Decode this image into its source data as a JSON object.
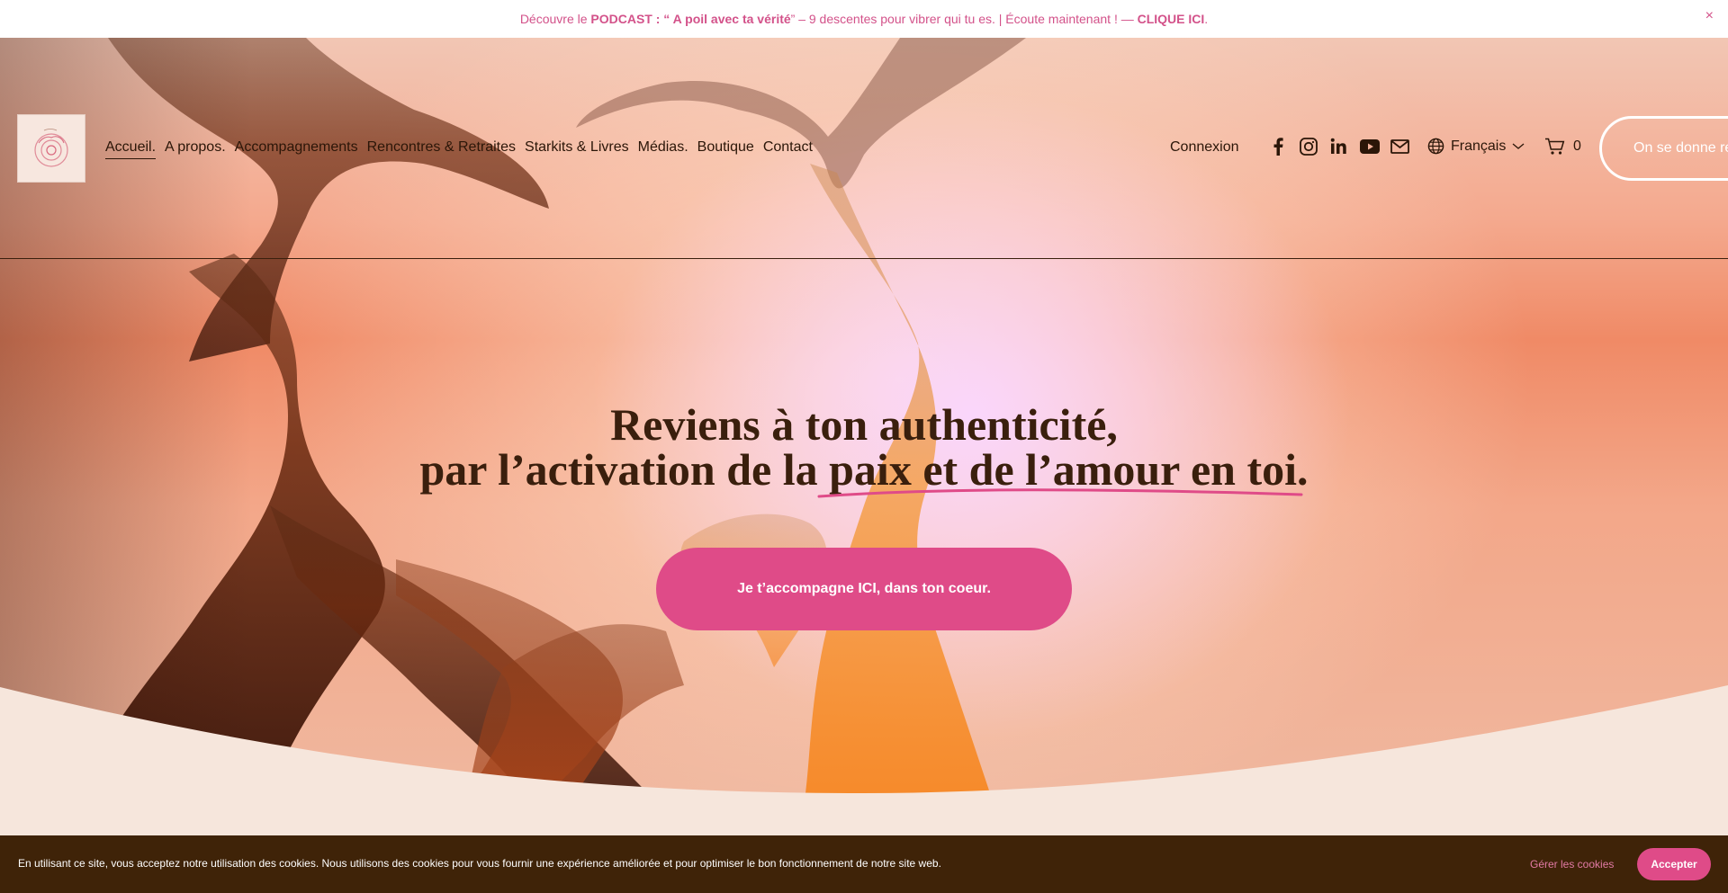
{
  "announcement": {
    "prefix": "Découvre le ",
    "podcast_label": "PODCAST",
    "sep": " : “ ",
    "podcast_title": "A poil avec ta vérité",
    "middle": "” – 9 descentes pour vibrer qui tu es. | Écoute maintenant ! — ",
    "cta": "CLIQUE ICI",
    "suffix": ".",
    "close": "×"
  },
  "nav": {
    "items": [
      {
        "label": "Accueil."
      },
      {
        "label": "A propos."
      },
      {
        "label": "Accompagnements"
      },
      {
        "label": "Rencontres & Retraites"
      },
      {
        "label": "Starkits & Livres"
      },
      {
        "label": "Médias."
      },
      {
        "label": "Boutique"
      },
      {
        "label": "Contact"
      }
    ],
    "login": "Connexion",
    "language": "Français",
    "cart_count": "0",
    "cta": "On se donne rendez-vous"
  },
  "hero": {
    "line1": "Reviens à ton authenticité,",
    "line2_pre": "par l’activation de la ",
    "line2_hl": "paix et de l’amour en toi",
    "line2_post": ".",
    "button": "Je t’accompagne ICI, dans ton coeur."
  },
  "cookie": {
    "message": "En utilisant ce site, vous acceptez notre utilisation des cookies. Nous utilisons des cookies pour vous fournir une expérience améliorée et pour optimiser le bon fonctionnement de notre site web.",
    "manage": "Gérer les cookies",
    "accept": "Accepter"
  },
  "colors": {
    "accent": "#df4b88",
    "text_dark": "#3a1f0d",
    "cookie_bg": "#3f2308",
    "page_bg": "#f6e6dc"
  }
}
